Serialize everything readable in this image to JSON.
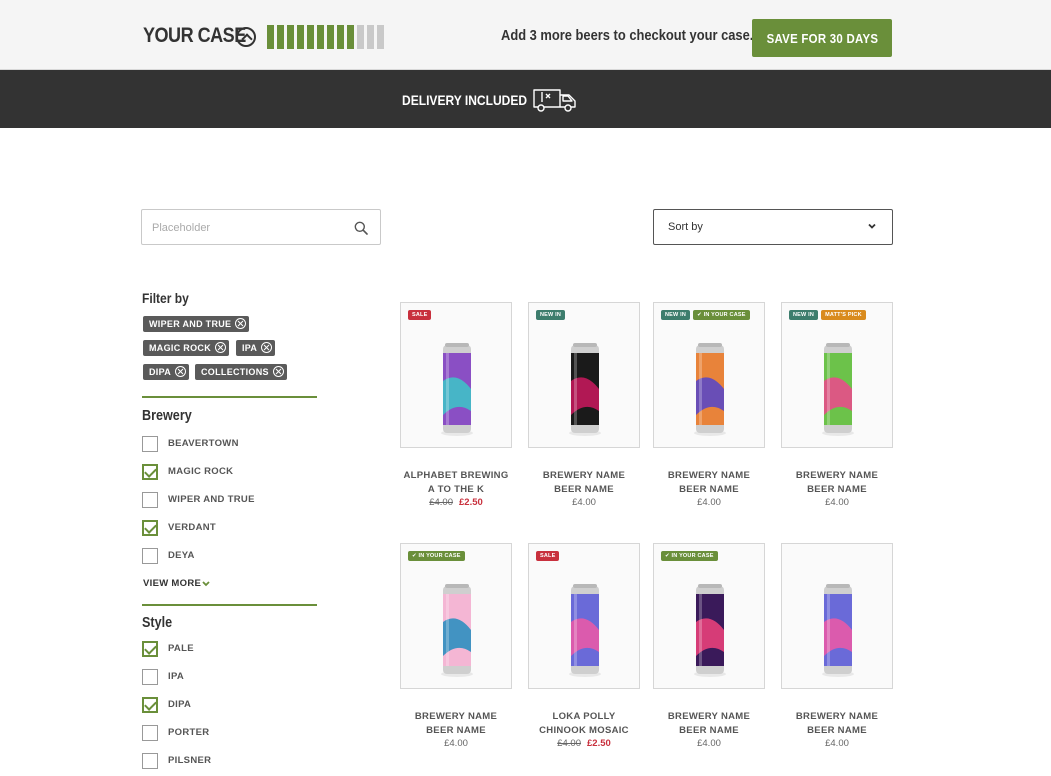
{
  "case": {
    "title": "YOUR CASE",
    "bottles_filled": 9,
    "bottles_total": 12,
    "message": "Add 3 more beers to checkout your case.",
    "save_label": "SAVE FOR 30 DAYS",
    "accent": "#6a8f3a"
  },
  "delivery": {
    "text": "DELIVERY INCLUDED",
    "icon": "delivery-van-icon"
  },
  "search": {
    "placeholder": "Placeholder",
    "value": ""
  },
  "sort": {
    "label": "Sort by"
  },
  "filters": {
    "title": "Filter by",
    "chips": [
      "WIPER AND TRUE",
      "MAGIC ROCK",
      "IPA",
      "DIPA",
      "COLLECTIONS"
    ]
  },
  "brewery": {
    "title": "Brewery",
    "options": [
      {
        "label": "BEAVERTOWN",
        "checked": false
      },
      {
        "label": "MAGIC ROCK",
        "checked": true
      },
      {
        "label": "WIPER AND TRUE",
        "checked": false
      },
      {
        "label": "VERDANT",
        "checked": true
      },
      {
        "label": "DEYA",
        "checked": false
      }
    ],
    "view_more": "VIEW MORE"
  },
  "style": {
    "title": "Style",
    "options": [
      {
        "label": "PALE",
        "checked": true
      },
      {
        "label": "IPA",
        "checked": false
      },
      {
        "label": "DIPA",
        "checked": true
      },
      {
        "label": "PORTER",
        "checked": false
      },
      {
        "label": "PILSNER",
        "checked": false
      }
    ]
  },
  "products": [
    {
      "badges": [
        {
          "type": "sale",
          "text": "SALE"
        }
      ],
      "brewery": "ALPHABET BREWING",
      "beer": "A TO THE K",
      "price_was": "£4.00",
      "price_now": "£2.50",
      "can_colors": [
        "#8a4fc4",
        "#3fc0c8"
      ]
    },
    {
      "badges": [
        {
          "type": "new",
          "text": "NEW IN"
        }
      ],
      "brewery": "BREWERY NAME",
      "beer": "BEER NAME",
      "price": "£4.00",
      "can_colors": [
        "#1a1a1a",
        "#c2185b"
      ]
    },
    {
      "badges": [
        {
          "type": "new",
          "text": "NEW IN"
        },
        {
          "type": "incase",
          "text": "✔ IN YOUR CASE"
        }
      ],
      "brewery": "BREWERY NAME",
      "beer": "BEER NAME",
      "price": "£4.00",
      "can_colors": [
        "#e8833a",
        "#5b48c4"
      ]
    },
    {
      "badges": [
        {
          "type": "new",
          "text": "NEW IN"
        },
        {
          "type": "pick",
          "text": "MATT'S PICK"
        }
      ],
      "brewery": "BREWERY NAME",
      "beer": "BEER NAME",
      "price": "£4.00",
      "can_colors": [
        "#6cc24a",
        "#e84e8a"
      ]
    },
    {
      "badges": [
        {
          "type": "incase",
          "text": "✔ IN YOUR CASE"
        }
      ],
      "brewery": "BREWERY NAME",
      "beer": "BEER NAME",
      "price": "£4.00",
      "can_colors": [
        "#f4b6d4",
        "#2f8fc0"
      ]
    },
    {
      "badges": [
        {
          "type": "sale",
          "text": "SALE"
        }
      ],
      "brewery": "LOKA POLLY",
      "beer": "CHINOOK MOSAIC",
      "price_was": "£4.00",
      "price_now": "£2.50",
      "can_colors": [
        "#6a6ad8",
        "#e85aa8"
      ]
    },
    {
      "badges": [
        {
          "type": "incase",
          "text": "✔ IN YOUR CASE"
        }
      ],
      "brewery": "BREWERY NAME",
      "beer": "BEER NAME",
      "price": "£4.00",
      "can_colors": [
        "#3a1a5a",
        "#e8407a"
      ]
    },
    {
      "badges": [],
      "brewery": "BREWERY NAME",
      "beer": "BEER NAME",
      "price": "£4.00",
      "can_colors": [
        "#6a6ad8",
        "#e85aa8"
      ]
    }
  ]
}
